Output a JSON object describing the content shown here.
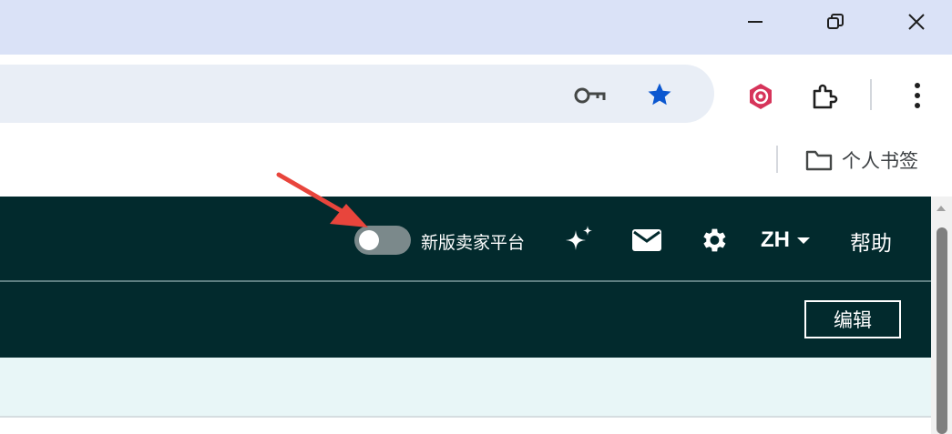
{
  "browser": {
    "window_controls": {
      "minimize": "minimize-icon",
      "restore": "restore-icon",
      "close": "close-icon"
    },
    "toolbar": {
      "icons": [
        "key-icon",
        "star-icon",
        "extension-badge-icon",
        "puzzle-icon",
        "more-vert-icon"
      ],
      "star_color": "#0b57d0"
    },
    "bookmarks_bar": {
      "item_label": "个人书签",
      "item_icon": "folder-icon"
    }
  },
  "seller_app": {
    "header": {
      "toggle_label": "新版卖家平台",
      "toggle_on": false,
      "language": "ZH",
      "help_label": "帮助",
      "icons": [
        "sparkle-icon",
        "mail-icon",
        "gear-icon"
      ]
    },
    "subbar": {
      "edit_label": "编辑"
    },
    "colors": {
      "header_bg": "#022a2d",
      "content_band": "#e8f6f7",
      "annotation_arrow": "#e8453c"
    }
  }
}
